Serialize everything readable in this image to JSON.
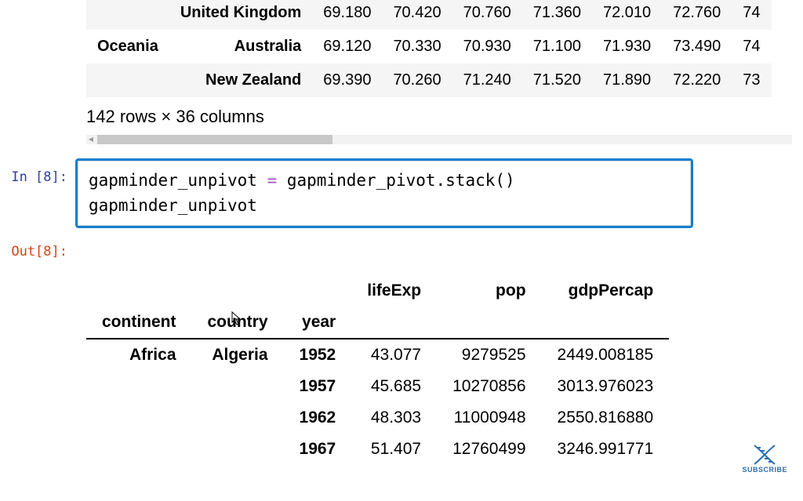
{
  "pivot": {
    "rows": [
      {
        "continent": "",
        "country": "United Kingdom",
        "values": [
          "69.180",
          "70.420",
          "70.760",
          "71.360",
          "72.010",
          "72.760",
          "74"
        ],
        "even": true
      },
      {
        "continent": "Oceania",
        "country": "Australia",
        "values": [
          "69.120",
          "70.330",
          "70.930",
          "71.100",
          "71.930",
          "73.490",
          "74"
        ],
        "even": false
      },
      {
        "continent": "",
        "country": "New Zealand",
        "values": [
          "69.390",
          "70.260",
          "71.240",
          "71.520",
          "71.890",
          "72.220",
          "73"
        ],
        "even": true
      }
    ],
    "shape_text": "142 rows × 36 columns"
  },
  "code_cell": {
    "prompt_in": "In [8]:",
    "prompt_out": "Out[8]:",
    "line1_left": "gapminder_unpivot ",
    "line1_op": "=",
    "line1_right": " gapminder_pivot.stack()",
    "line2": "gapminder_unpivot"
  },
  "unpivot": {
    "col_headers": [
      "lifeExp",
      "pop",
      "gdpPercap"
    ],
    "index_headers": [
      "continent",
      "country",
      "year"
    ],
    "rows": [
      {
        "continent": "Africa",
        "country": "Algeria",
        "year": "1952",
        "lifeExp": "43.077",
        "pop": "9279525",
        "gdp": "2449.008185"
      },
      {
        "continent": "",
        "country": "",
        "year": "1957",
        "lifeExp": "45.685",
        "pop": "10270856",
        "gdp": "3013.976023"
      },
      {
        "continent": "",
        "country": "",
        "year": "1962",
        "lifeExp": "48.303",
        "pop": "11000948",
        "gdp": "2550.816880"
      },
      {
        "continent": "",
        "country": "",
        "year": "1967",
        "lifeExp": "51.407",
        "pop": "12760499",
        "gdp": "3246.991771"
      }
    ]
  },
  "subscribe": {
    "label": "SUBSCRIBE"
  }
}
